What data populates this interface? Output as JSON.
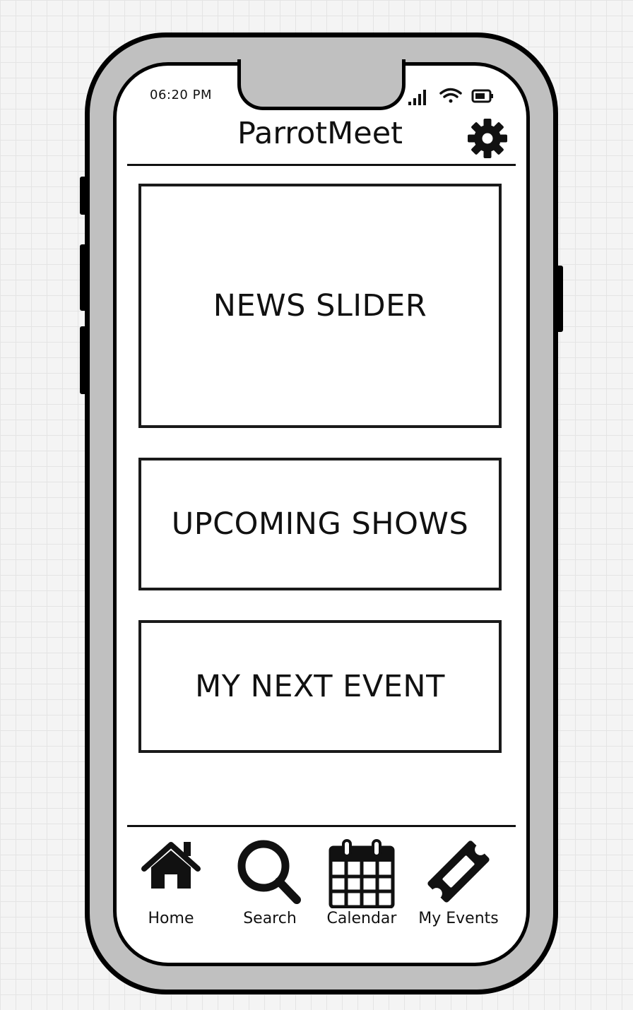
{
  "status_bar": {
    "time": "06:20 PM",
    "icons": [
      "signal-icon",
      "wifi-icon",
      "battery-icon"
    ]
  },
  "header": {
    "title": "ParrotMeet",
    "settings_icon": "gear-icon"
  },
  "sections": [
    {
      "label": "NEWS SLIDER"
    },
    {
      "label": "UPCOMING SHOWS"
    },
    {
      "label": "MY NEXT EVENT"
    }
  ],
  "bottom_nav": {
    "items": [
      {
        "label": "Home",
        "icon": "home-icon"
      },
      {
        "label": "Search",
        "icon": "search-icon"
      },
      {
        "label": "Calendar",
        "icon": "calendar-icon"
      },
      {
        "label": "My Events",
        "icon": "ticket-icon"
      }
    ]
  },
  "colors": {
    "frame": "#c0c0c0",
    "ink": "#000000",
    "screen": "#ffffff",
    "canvas": "#f4f4f4"
  }
}
